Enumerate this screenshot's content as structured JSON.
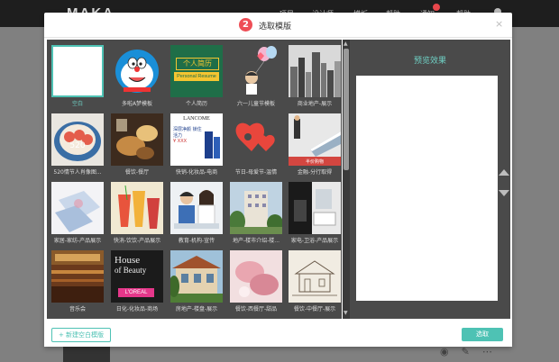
{
  "app": {
    "logo": "MAKA",
    "nav": [
      {
        "label": "项目",
        "x": 0
      },
      {
        "label": "设计师",
        "x": 0
      },
      {
        "label": "模板",
        "x": 0
      },
      {
        "label": "帮助",
        "x": 0
      },
      {
        "label": "通知",
        "x": 0
      },
      {
        "label": "帮助",
        "x": 0
      }
    ]
  },
  "dialog": {
    "step_number": "2",
    "title": "选取模版",
    "close": "×",
    "preview_title": "预览效果",
    "new_button": "+ 新建空白模版",
    "ok_button": "选取",
    "templates": [
      {
        "label": "空白"
      },
      {
        "label": "多啦A梦模板"
      },
      {
        "label": "个人简历"
      },
      {
        "label": "六一儿童节模板"
      },
      {
        "label": "商业地产-展示"
      },
      {
        "label": "520情节人肖像图..."
      },
      {
        "label": "餐饮-餐厅"
      },
      {
        "label": "快销-化妆品-电商"
      },
      {
        "label": "节日-母爱节-温情"
      },
      {
        "label": "金融-分行取得"
      },
      {
        "label": "家居-家纺-产品展示"
      },
      {
        "label": "快消-饮饮-产品展示"
      },
      {
        "label": "教育-机构-宣传"
      },
      {
        "label": "地产-楼市介绍-楼..."
      },
      {
        "label": "家电-卫浴-产品展示"
      },
      {
        "label": "音乐会"
      },
      {
        "label": "日化-化妆品-商场"
      },
      {
        "label": "房地产-楼盘-展示"
      },
      {
        "label": "餐饮-西餐厅-甜品"
      },
      {
        "label": "餐饮-中餐厅-展示"
      }
    ]
  },
  "thumbs": {
    "resume_top": "个人简历",
    "resume_bottom": "Personal Resume",
    "lancome_brand": "LANCOME",
    "lancome_text1": "深层净颜 锁住活力",
    "lancome_price": "¥ XXX",
    "finance_text": "半价购物",
    "house_line1": "House",
    "house_line2": "of Beauty",
    "house_brand": "L'OREAL",
    "food_numbers": "520"
  },
  "colors": {
    "accent": "#4ec2b4",
    "step": "#ee4e56",
    "panel": "#4a4a4a"
  }
}
